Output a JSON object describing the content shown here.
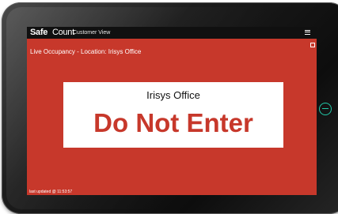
{
  "app": {
    "brand_bold": "Safe",
    "brand_regular": "Count",
    "view_label": "Customer View",
    "menu_icon": "hamburger-icon",
    "expand_icon": "expand-icon"
  },
  "page": {
    "title": "Live Occupancy - Location: Irisys Office",
    "background_color": "#c7382b"
  },
  "status_card": {
    "location_name": "Irisys Office",
    "message": "Do Not Enter",
    "message_color": "#c7382b"
  },
  "footer": {
    "last_updated": "last updated @ 11:53:57"
  },
  "device": {
    "home_button_icon": "home-button-icon",
    "accent_color": "#22c9a8"
  }
}
